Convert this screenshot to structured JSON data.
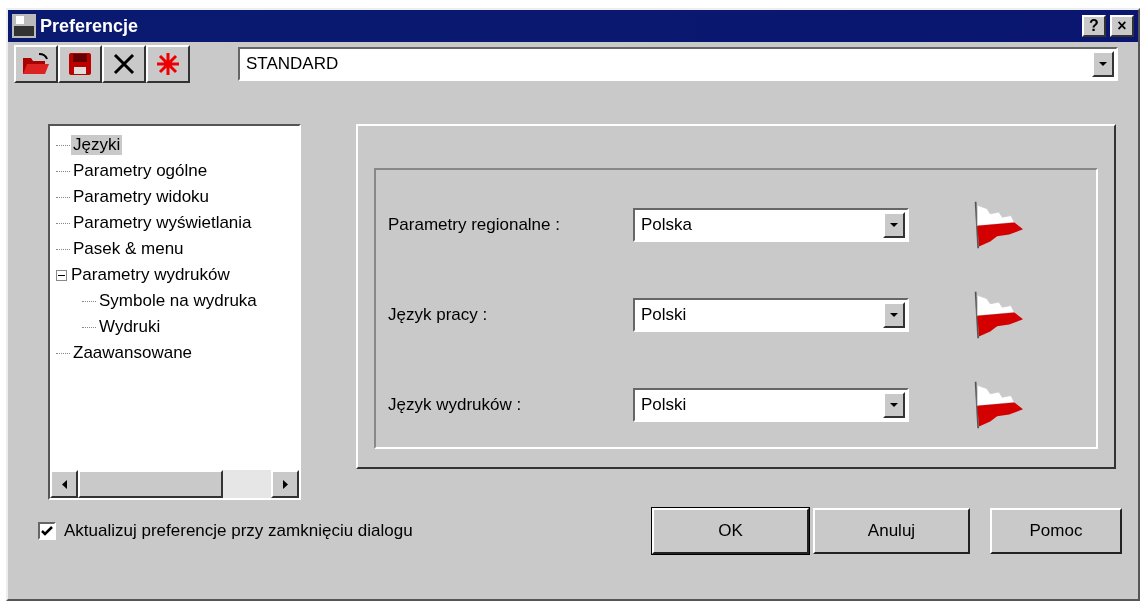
{
  "window": {
    "title": "Preferencje",
    "help_button": "?",
    "close_button": "×"
  },
  "toolbar": {
    "profile": "STANDARD"
  },
  "tree": [
    {
      "label": "Języki",
      "selected": true
    },
    {
      "label": "Parametry ogólne",
      "selected": false
    },
    {
      "label": "Parametry widoku",
      "selected": false
    },
    {
      "label": "Parametry wyświetlania",
      "selected": false
    },
    {
      "label": "Pasek & menu",
      "selected": false
    },
    {
      "label": "Parametry wydruków",
      "selected": false,
      "expanded": true,
      "children": [
        {
          "label": "Symbole na wydruka",
          "selected": false
        },
        {
          "label": "Wydruki",
          "selected": false
        }
      ]
    },
    {
      "label": "Zaawansowane",
      "selected": false
    }
  ],
  "settings": [
    {
      "label": "Parametry regionalne :",
      "value": "Polska"
    },
    {
      "label": "Język pracy :",
      "value": "Polski"
    },
    {
      "label": "Język wydruków :",
      "value": "Polski"
    }
  ],
  "update_on_close": {
    "label": "Aktualizuj preferencje przy zamknięciu dialogu",
    "checked": true
  },
  "buttons": [
    "OK",
    "Anuluj",
    "Pomoc"
  ]
}
